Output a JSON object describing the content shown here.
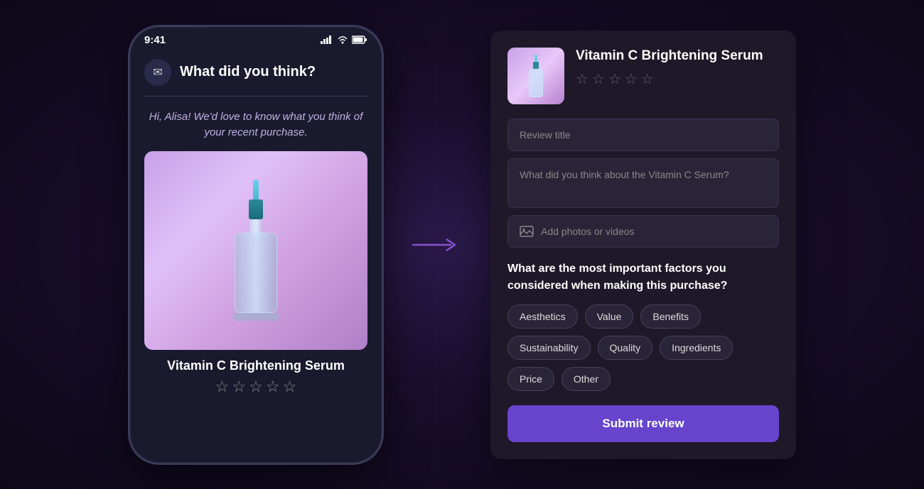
{
  "phone": {
    "status_bar": {
      "time": "9:41",
      "signal": "signal-icon",
      "wifi": "wifi-icon",
      "battery": "battery-icon"
    },
    "header": {
      "icon": "✉",
      "title": "What did you think?"
    },
    "body_text": "Hi, Alisa! We'd love to know what you think of your recent purchase.",
    "product_name": "Vitamin C Brightening Serum",
    "stars": [
      "☆",
      "☆",
      "☆",
      "☆",
      "☆"
    ]
  },
  "arrow": "→",
  "review_panel": {
    "product": {
      "title": "Vitamin C Brightening Serum",
      "stars": [
        "☆",
        "☆",
        "☆",
        "☆",
        "☆"
      ]
    },
    "fields": {
      "review_title_placeholder": "Review title",
      "review_body_placeholder": "What did you think about the Vitamin C Serum?",
      "add_media_label": "Add photos or videos"
    },
    "question": "What are the most important factors you considered when making this purchase?",
    "tags": [
      "Aesthetics",
      "Value",
      "Benefits",
      "Sustainability",
      "Quality",
      "Ingredients",
      "Price",
      "Other"
    ],
    "submit_label": "Submit review"
  }
}
